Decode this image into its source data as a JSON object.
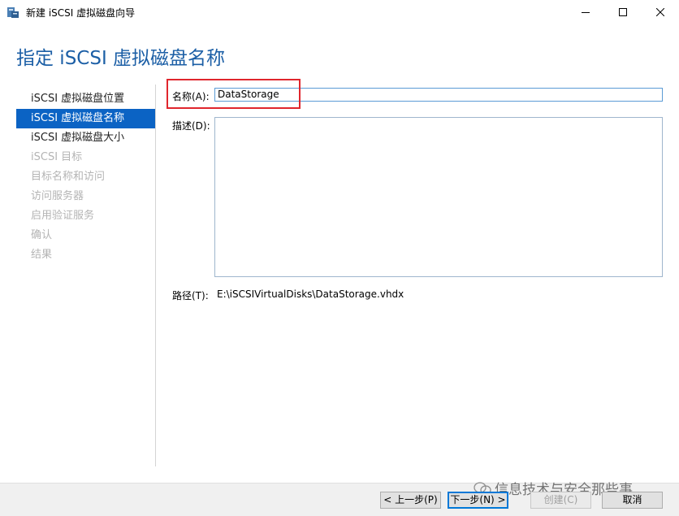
{
  "window": {
    "title": "新建 iSCSI 虚拟磁盘向导"
  },
  "page": {
    "heading": "指定 iSCSI 虚拟磁盘名称"
  },
  "nav": {
    "items": [
      {
        "label": "iSCSI 虚拟磁盘位置",
        "state": "normal"
      },
      {
        "label": "iSCSI 虚拟磁盘名称",
        "state": "active"
      },
      {
        "label": "iSCSI 虚拟磁盘大小",
        "state": "normal"
      },
      {
        "label": "iSCSI 目标",
        "state": "disabled"
      },
      {
        "label": "目标名称和访问",
        "state": "disabled"
      },
      {
        "label": "访问服务器",
        "state": "disabled"
      },
      {
        "label": "启用验证服务",
        "state": "disabled"
      },
      {
        "label": "确认",
        "state": "disabled"
      },
      {
        "label": "结果",
        "state": "disabled"
      }
    ]
  },
  "form": {
    "name_label": "名称(A):",
    "name_value": "DataStorage",
    "desc_label": "描述(D):",
    "desc_value": "",
    "path_label": "路径(T):",
    "path_value": "E:\\iSCSIVirtualDisks\\DataStorage.vhdx"
  },
  "buttons": {
    "prev": "< 上一步(P)",
    "next": "下一步(N) >",
    "create": "创建(C)",
    "cancel": "取消"
  },
  "watermark": {
    "text": "信息技术与安全那些事"
  },
  "colors": {
    "heading": "#1c5fa6",
    "nav_active_bg": "#0b63c4",
    "highlight": "#e0262d"
  }
}
